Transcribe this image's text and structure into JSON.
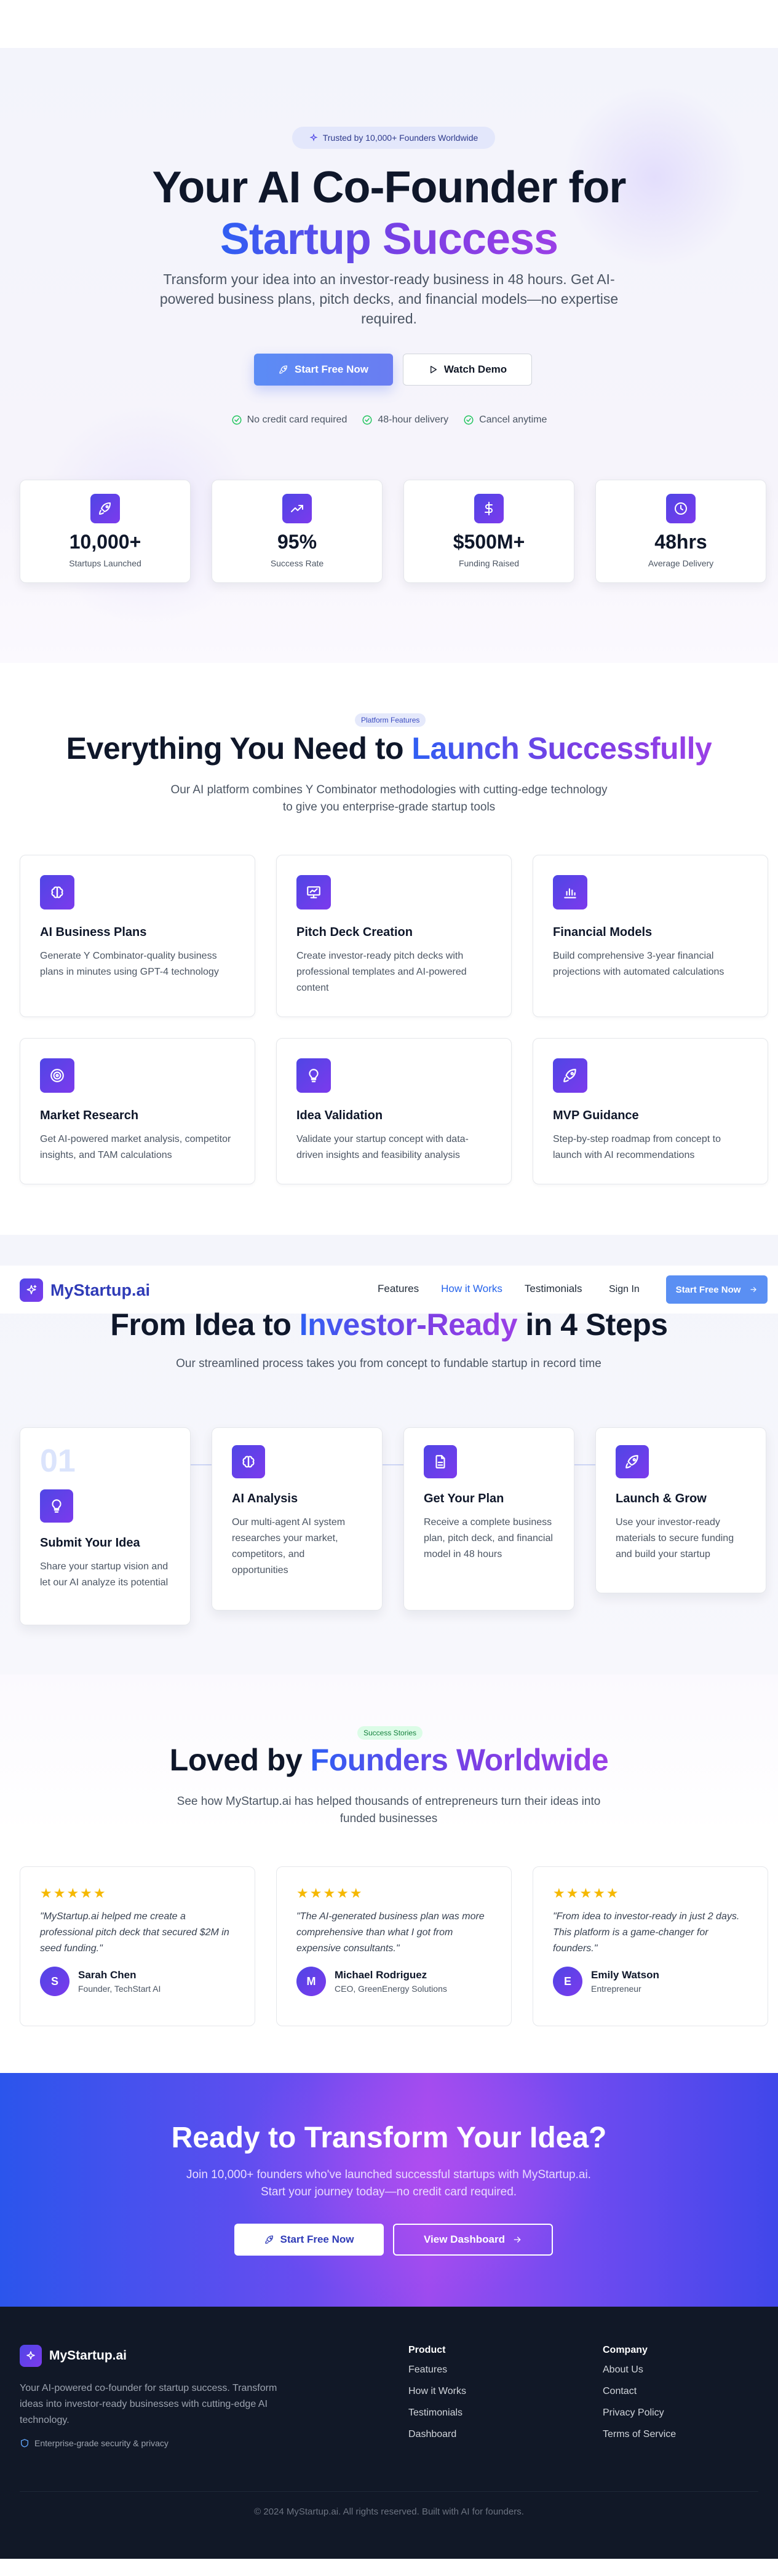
{
  "hero": {
    "badge": "Trusted by 10,000+ Founders Worldwide",
    "title_line1": "Your AI Co-Founder for",
    "title_line2": "Startup Success",
    "subtitle": "Transform your idea into an investor-ready business in 48 hours. Get AI-powered business plans, pitch decks, and financial models—no expertise required.",
    "primary_button": "Start Free Now",
    "secondary_button": "Watch Demo",
    "perks": [
      "No credit card required",
      "48-hour delivery",
      "Cancel anytime"
    ],
    "stats": [
      {
        "value": "10,000+",
        "label": "Startups Launched",
        "icon": "rocket-icon"
      },
      {
        "value": "95%",
        "label": "Success Rate",
        "icon": "trending-up-icon"
      },
      {
        "value": "$500M+",
        "label": "Funding Raised",
        "icon": "dollar-icon"
      },
      {
        "value": "48hrs",
        "label": "Average Delivery",
        "icon": "clock-icon"
      }
    ]
  },
  "features": {
    "pill": "Platform Features",
    "title_plain": "Everything You Need to ",
    "title_grad": "Launch Successfully",
    "subtitle": "Our AI platform combines Y Combinator methodologies with cutting-edge technology to give you enterprise-grade startup tools",
    "items": [
      {
        "title": "AI Business Plans",
        "desc": "Generate Y Combinator-quality business plans in minutes using GPT-4 technology",
        "icon": "brain-icon"
      },
      {
        "title": "Pitch Deck Creation",
        "desc": "Create investor-ready pitch decks with professional templates and AI-powered content",
        "icon": "presentation-icon"
      },
      {
        "title": "Financial Models",
        "desc": "Build comprehensive 3-year financial projections with automated calculations",
        "icon": "bar-chart-icon"
      },
      {
        "title": "Market Research",
        "desc": "Get AI-powered market analysis, competitor insights, and TAM calculations",
        "icon": "target-icon"
      },
      {
        "title": "Idea Validation",
        "desc": "Validate your startup concept with data-driven insights and feasibility analysis",
        "icon": "lightbulb-icon"
      },
      {
        "title": "MVP Guidance",
        "desc": "Step-by-step roadmap from concept to launch with AI recommendations",
        "icon": "rocket-icon"
      }
    ]
  },
  "nav": {
    "brand": "MyStartup.ai",
    "links": [
      "Features",
      "How it Works",
      "Testimonials"
    ],
    "signin": "Sign In",
    "cta": "Start Free Now"
  },
  "how": {
    "title_plain1": "From Idea to ",
    "title_grad": "Investor-Ready",
    "title_plain2": " in 4 Steps",
    "subtitle": "Our streamlined process takes you from concept to fundable startup in record time",
    "step1_num": "01",
    "steps": [
      {
        "title": "Submit Your Idea",
        "desc": "Share your startup vision and let our AI analyze its potential",
        "icon": "lightbulb-icon"
      },
      {
        "title": "AI Analysis",
        "desc": "Our multi-agent AI system researches your market, competitors, and opportunities",
        "icon": "brain-icon"
      },
      {
        "title": "Get Your Plan",
        "desc": "Receive a complete business plan, pitch deck, and financial model in 48 hours",
        "icon": "document-icon"
      },
      {
        "title": "Launch & Grow",
        "desc": "Use your investor-ready materials to secure funding and build your startup",
        "icon": "rocket-icon"
      }
    ]
  },
  "testimonials": {
    "pill": "Success Stories",
    "title_plain": "Loved by ",
    "title_grad": "Founders Worldwide",
    "subtitle": "See how MyStartup.ai has helped thousands of entrepreneurs turn their ideas into funded businesses",
    "stars": "★★★★★",
    "items": [
      {
        "quote": "\"MyStartup.ai helped me create a professional pitch deck that secured $2M in seed funding.\"",
        "name": "Sarah Chen",
        "role": "Founder, TechStart AI",
        "initial": "S"
      },
      {
        "quote": "\"The AI-generated business plan was more comprehensive than what I got from expensive consultants.\"",
        "name": "Michael Rodriguez",
        "role": "CEO, GreenEnergy Solutions",
        "initial": "M"
      },
      {
        "quote": "\"From idea to investor-ready in just 2 days. This platform is a game-changer for founders.\"",
        "name": "Emily Watson",
        "role": "Entrepreneur",
        "initial": "E"
      }
    ]
  },
  "cta": {
    "title": "Ready to Transform Your Idea?",
    "subtitle": "Join 10,000+ founders who've launched successful startups with MyStartup.ai. Start your journey today—no credit card required.",
    "primary": "Start Free Now",
    "secondary": "View Dashboard"
  },
  "footer": {
    "brand": "MyStartup.ai",
    "desc": "Your AI-powered co-founder for startup success. Transform ideas into investor-ready businesses with cutting-edge AI technology.",
    "security": "Enterprise-grade security & privacy",
    "product_title": "Product",
    "product_links": [
      "Features",
      "How it Works",
      "Testimonials",
      "Dashboard"
    ],
    "company_title": "Company",
    "company_links": [
      "About Us",
      "Contact",
      "Privacy Policy",
      "Terms of Service"
    ],
    "copyright": "© 2024 MyStartup.ai. All rights reserved. Built with AI for founders."
  },
  "colors": {
    "accent_blue": "#5a8ff3",
    "brand_indigo": "#4f46e5",
    "brand_purple": "#7c3aed",
    "footer_bg": "#111827",
    "star": "#f5b800"
  }
}
